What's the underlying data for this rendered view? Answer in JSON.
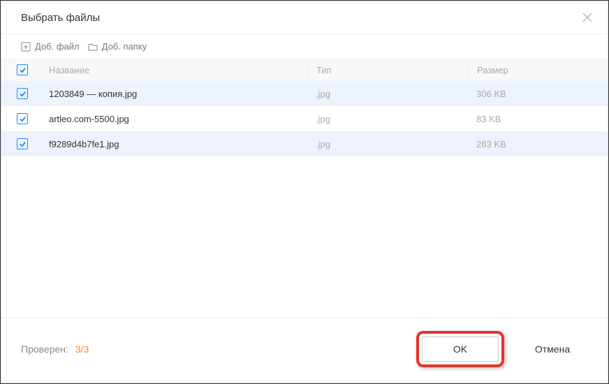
{
  "dialog": {
    "title": "Выбрать файлы"
  },
  "toolbar": {
    "add_file": "Доб. файл",
    "add_folder": "Доб. папку"
  },
  "headers": {
    "name": "Название",
    "type": "Тип",
    "size": "Размер"
  },
  "rows": [
    {
      "checked": true,
      "name": "1203849 — копия.jpg",
      "type": ".jpg",
      "size": "306 KB"
    },
    {
      "checked": true,
      "name": "artleo.com-5500.jpg",
      "type": ".jpg",
      "size": "83 KB"
    },
    {
      "checked": true,
      "name": "f9289d4b7fe1.jpg",
      "type": ".jpg",
      "size": "283 KB"
    }
  ],
  "footer": {
    "status_label": "Проверен:",
    "status_count": "3/3",
    "ok": "OK",
    "cancel": "Отмена"
  }
}
